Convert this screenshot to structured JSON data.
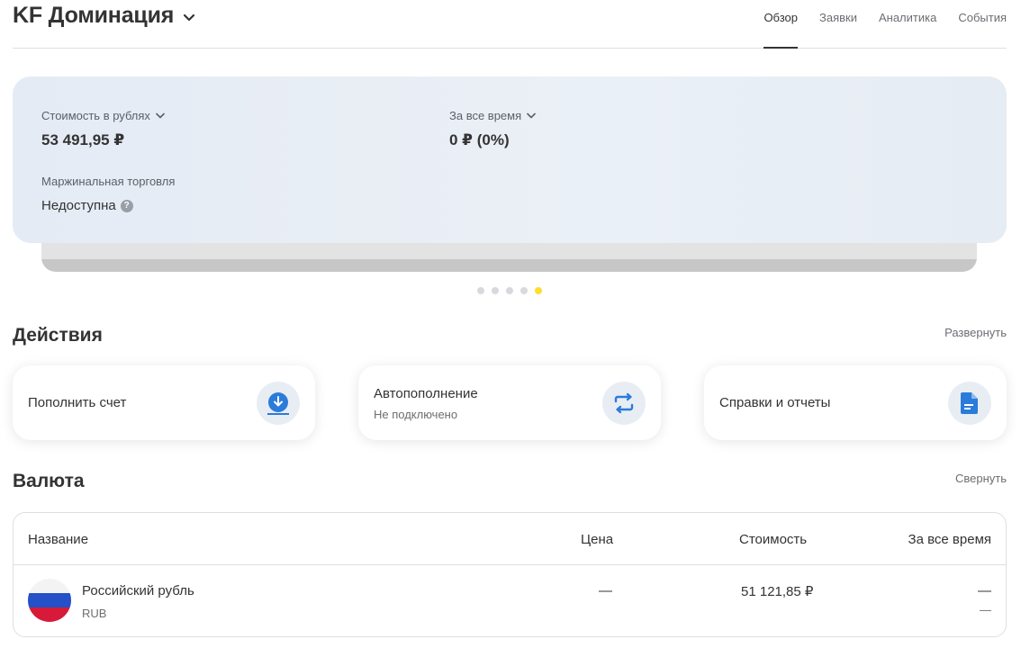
{
  "header": {
    "title": "KF Доминация",
    "tabs": [
      {
        "label": "Обзор",
        "active": true
      },
      {
        "label": "Заявки",
        "active": false
      },
      {
        "label": "Аналитика",
        "active": false
      },
      {
        "label": "События",
        "active": false
      }
    ]
  },
  "summary": {
    "value_label": "Стоимость в рублях",
    "value": "53 491,95 ₽",
    "period_label": "За все время",
    "period_value": "0 ₽ (0%)",
    "margin_label": "Маржинальная торговля",
    "margin_value": "Недоступна",
    "carousel": {
      "count": 5,
      "active_index": 4
    }
  },
  "actions": {
    "title": "Действия",
    "expand_label": "Развернуть",
    "items": [
      {
        "label": "Пополнить счет",
        "sub": "",
        "icon": "download-icon"
      },
      {
        "label": "Автопополнение",
        "sub": "Не подключено",
        "icon": "repeat-icon"
      },
      {
        "label": "Справки и отчеты",
        "sub": "",
        "icon": "document-icon"
      }
    ]
  },
  "currency": {
    "title": "Валюта",
    "collapse_label": "Свернуть",
    "columns": [
      "Название",
      "Цена",
      "Стоимость",
      "За все время"
    ],
    "rows": [
      {
        "name": "Российский рубль",
        "ticker": "RUB",
        "price": "—",
        "value": "51 121,85 ₽",
        "total": "—",
        "total_sub": "—",
        "icon": "russia-flag-icon"
      }
    ]
  },
  "colors": {
    "accent_yellow": "#ffdd2d",
    "icon_blue": "#2b7bdb",
    "card_bg": "#e8edf4"
  }
}
